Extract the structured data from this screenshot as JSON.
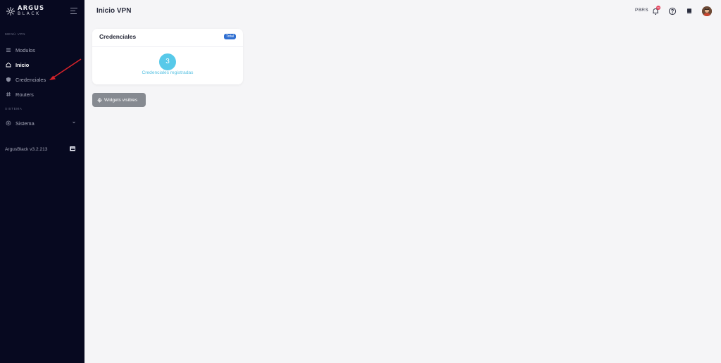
{
  "sidebar": {
    "logo_line1": "ARGUS",
    "logo_line2": "BLACK",
    "section_menu": "MENÚ VPN",
    "section_system": "SISTEMA",
    "items": [
      {
        "label": "Modulos",
        "icon": "grid-icon"
      },
      {
        "label": "Inicio",
        "icon": "home-icon",
        "active": true
      },
      {
        "label": "Credenciales",
        "icon": "shield-icon"
      },
      {
        "label": "Routers",
        "icon": "hash-icon"
      },
      {
        "label": "Sistema",
        "icon": "gear-icon"
      }
    ],
    "version": "ArgusBlack v3.2.213"
  },
  "header": {
    "title": "Inicio VPN",
    "org_code": "PBRS",
    "notification_count": "99"
  },
  "card": {
    "title": "Credenciales",
    "tag": "Total",
    "count": "3",
    "count_label": "Credenciales registradas"
  },
  "widgets_button": {
    "label": "Widgets visibles"
  },
  "colors": {
    "sidebar_bg": "#070920",
    "accent_cyan": "#57c9e9",
    "tag_blue": "#2f6fd1",
    "annotation_arrow": "#d8232a"
  }
}
